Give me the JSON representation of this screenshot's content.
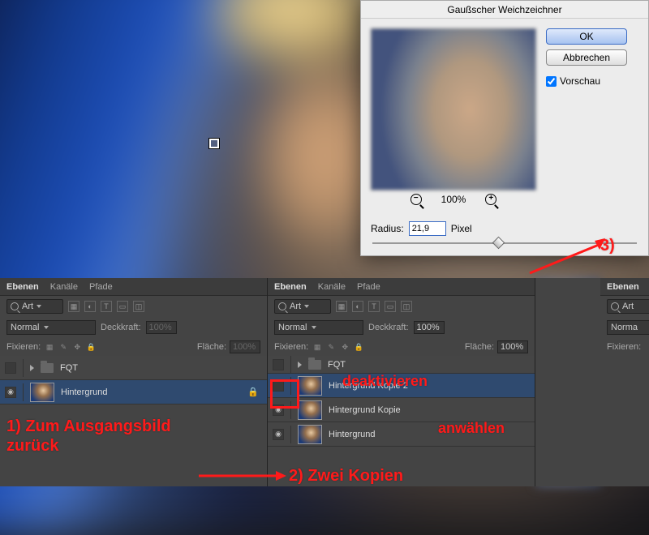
{
  "dialog": {
    "title": "Gaußscher Weichzeichner",
    "ok": "OK",
    "cancel": "Abbrechen",
    "preview_label": "Vorschau",
    "zoom_level": "100%",
    "radius_label": "Radius:",
    "radius_value": "21,9",
    "radius_unit": "Pixel"
  },
  "tabs": {
    "layers": "Ebenen",
    "channels": "Kanäle",
    "paths": "Pfade"
  },
  "search_label": "Art",
  "blend": {
    "mode": "Normal",
    "opacity_label": "Deckkraft:",
    "opacity": "100%"
  },
  "lock": {
    "label": "Fixieren:",
    "fill_label": "Fläche:",
    "fill": "100%"
  },
  "panel1": {
    "group": "FQT",
    "layer": "Hintergrund"
  },
  "panel2": {
    "group": "FQT",
    "layer3": "Hintergrund Kopie 2",
    "layer2": "Hintergrund Kopie",
    "layer1": "Hintergrund"
  },
  "panel3": {
    "tabs": "Ebenen",
    "search": "Art",
    "blend": "Norma",
    "lock": "Fixieren:"
  },
  "ann": {
    "step1a": "1) Zum Ausgangsbild",
    "step1b": "zurück",
    "step2": "2) Zwei Kopien",
    "step3": "3)",
    "deakt": "deaktivieren",
    "anw": "anwählen"
  }
}
